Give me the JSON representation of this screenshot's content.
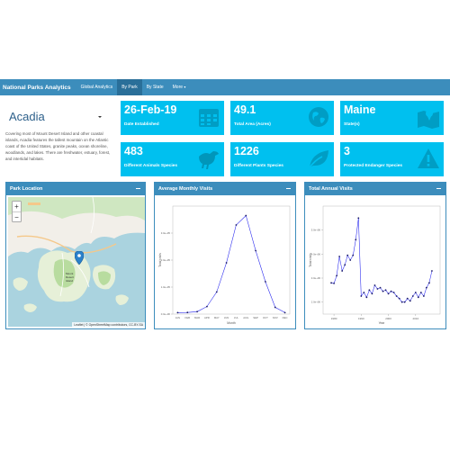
{
  "navbar": {
    "brand": "National Parks Analytics",
    "items": [
      {
        "label": "Global Analytics",
        "active": false
      },
      {
        "label": "By Park",
        "active": true
      },
      {
        "label": "By State",
        "active": false
      },
      {
        "label": "More",
        "active": false
      }
    ]
  },
  "park": {
    "name": "Acadia",
    "description": "Covering most of Mount Desert Island and other coastal islands, Acadia features the tallest mountain on the Atlantic coast of the United States, granite peaks, ocean shoreline, woodlands, and lakes. There are freshwater, estuary, forest, and intertidal habitats."
  },
  "value_boxes": [
    {
      "value": "26-Feb-19",
      "label": "Date Established",
      "icon": "calendar-icon"
    },
    {
      "value": "49.1",
      "label": "Total Area (Acres)",
      "icon": "globe-icon"
    },
    {
      "value": "Maine",
      "label": "State(s)",
      "icon": "map-icon"
    },
    {
      "value": "483",
      "label": "Different Animals Species",
      "icon": "crow-icon"
    },
    {
      "value": "1226",
      "label": "Different Plants Species",
      "icon": "leaf-icon"
    },
    {
      "value": "3",
      "label": "Protected Endanger Species",
      "icon": "warning-icon"
    }
  ],
  "colors": {
    "header_blue": "#3c8dbc",
    "value_box": "#00c0ef",
    "line": "#2222ee"
  },
  "map_panel": {
    "title": "Park Location",
    "zoom_in": "+",
    "zoom_out": "−",
    "attribution": "Leaflet | © OpenStreetMap contributors, CC-BY-SA",
    "labels": [
      "Mount",
      "Desert",
      "Island"
    ]
  },
  "chart_data": [
    {
      "type": "line",
      "title": "Average Monthly Visits",
      "xlabel": "Month",
      "ylabel": "Total visits",
      "categories": [
        "JAN",
        "FEB",
        "MAR",
        "APR",
        "MAY",
        "JUN",
        "JUL",
        "AUG",
        "SEP",
        "OCT",
        "NOV",
        "DEC"
      ],
      "values": [
        5500,
        6000,
        9000,
        28000,
        82000,
        190000,
        330000,
        365000,
        235000,
        120000,
        25000,
        5500
      ],
      "ylim": [
        0,
        400000
      ],
      "yticks": [
        0,
        100000,
        200000,
        300000
      ],
      "ytick_labels": [
        "0.0e+00",
        "1.0e+05",
        "2.0e+05",
        "3.0e+05"
      ]
    },
    {
      "type": "line",
      "title": "Total Annual Visits",
      "xlabel": "Year",
      "ylabel": "Total visits",
      "x": [
        1979,
        1980,
        1981,
        1982,
        1983,
        1984,
        1985,
        1986,
        1987,
        1988,
        1989,
        1990,
        1991,
        1992,
        1993,
        1994,
        1995,
        1996,
        1997,
        1998,
        1999,
        2000,
        2001,
        2002,
        2003,
        2004,
        2005,
        2006,
        2007,
        2008,
        2009,
        2010,
        2011,
        2012,
        2013,
        2014,
        2015,
        2016
      ],
      "y": [
        2800000,
        2780000,
        3100000,
        3900000,
        3300000,
        3550000,
        3950000,
        3750000,
        3950000,
        4600000,
        5500000,
        2250000,
        2400000,
        2200000,
        2500000,
        2350000,
        2700000,
        2550000,
        2600000,
        2450000,
        2500000,
        2350000,
        2450000,
        2400000,
        2250000,
        2150000,
        2000000,
        2000000,
        2150000,
        2050000,
        2250000,
        2400000,
        2200000,
        2400000,
        2250000,
        2600000,
        2800000,
        3300000
      ],
      "xlim": [
        1976,
        2019
      ],
      "ylim": [
        1500000,
        6000000
      ],
      "xticks": [
        1980,
        1990,
        2000,
        2010
      ],
      "yticks": [
        2000000,
        3000000,
        4000000,
        5000000
      ],
      "ytick_labels": [
        "2.0e+06",
        "3.0e+06",
        "4.0e+06",
        "5.0e+06"
      ]
    }
  ]
}
